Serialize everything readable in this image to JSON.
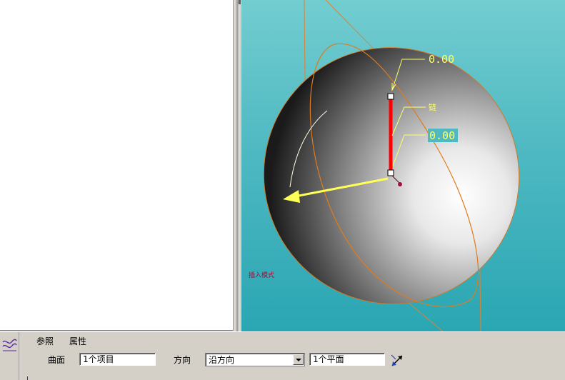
{
  "viewport": {
    "dimension_top": "0.00",
    "dimension_mid": "0.00",
    "chain_label": "链",
    "mode_text": "插入模式"
  },
  "dashboard": {
    "tabs": [
      "参照",
      "属性"
    ],
    "surface_label": "曲面",
    "surface_value": "1个项目",
    "direction_label": "方向",
    "direction_value": "沿方向",
    "plane_value": "1个平面"
  },
  "colors": {
    "viewport_bg": "#4fb9c2",
    "model_edge": "#e07b1c",
    "dimension": "#ffff66",
    "direction_arrow": "#ffff55",
    "chain": "#ff0000"
  }
}
